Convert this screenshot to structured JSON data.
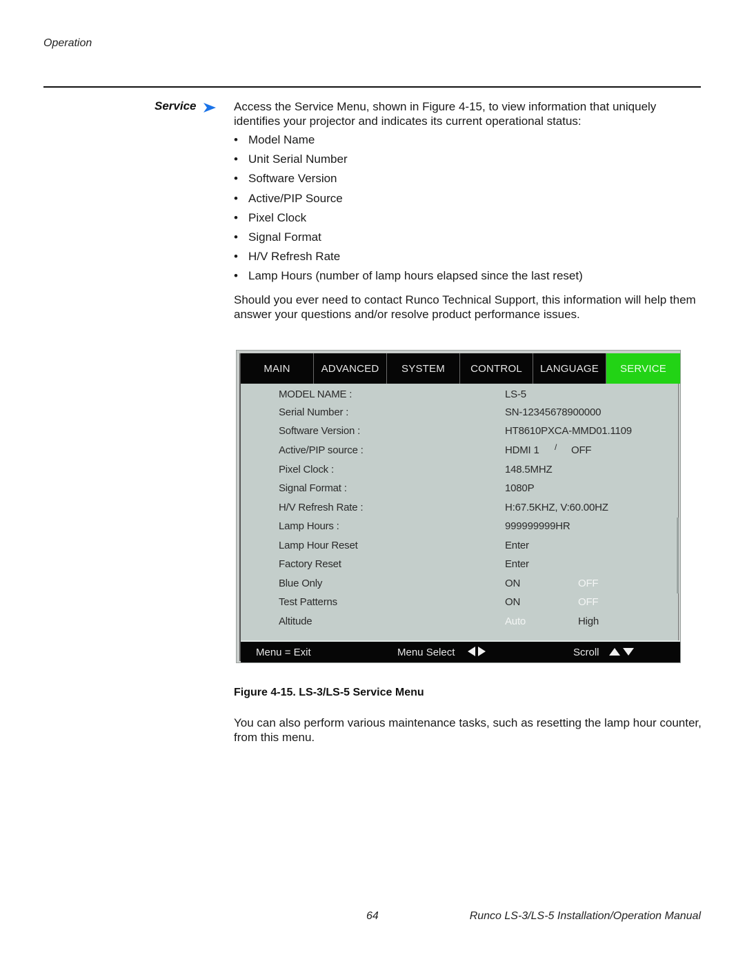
{
  "header": {
    "running_head": "Operation"
  },
  "section": {
    "side_head": "Service",
    "side_head_icon": "arrow-right-icon",
    "accent_color": "#1a73e8",
    "intro": "Access the Service Menu, shown in Figure 4-15, to view information that uniquely identifies your projector and indicates its current operational status:",
    "bullets": [
      "Model Name",
      "Unit Serial Number",
      "Software Version",
      "Active/PIP Source",
      "Pixel Clock",
      "Signal Format",
      "H/V Refresh Rate",
      "Lamp Hours (number of lamp hours elapsed since the last reset)"
    ],
    "bullet_glyph": "•",
    "support_text": "Should you ever need to contact Runco Technical Support, this information will help them answer your questions and/or resolve product performance issues."
  },
  "osd_menu": {
    "active_tab_color": "#22d315",
    "tabs": [
      {
        "label": "MAIN",
        "active": false
      },
      {
        "label": "ADVANCED",
        "active": false
      },
      {
        "label": "SYSTEM",
        "active": false
      },
      {
        "label": "CONTROL",
        "active": false
      },
      {
        "label": "LANGUAGE",
        "active": false
      },
      {
        "label": "SERVICE",
        "active": true
      }
    ],
    "rows": [
      {
        "label": "MODEL NAME :",
        "value": "LS-5"
      },
      {
        "label": "Serial Number :",
        "value": "SN-12345678900000"
      },
      {
        "label": "Software Version :",
        "value": "HT8610PXCA-MMD01.1109"
      },
      {
        "label": "Active/PIP source :",
        "value": "HDMI 1",
        "separator": "/",
        "value2": "OFF"
      },
      {
        "label": "Pixel Clock :",
        "value": "148.5MHZ"
      },
      {
        "label": "Signal Format :",
        "value": "1080P"
      },
      {
        "label": "H/V Refresh Rate :",
        "value": "H:67.5KHZ, V:60.00HZ"
      },
      {
        "label": "Lamp Hours :",
        "value": "999999999HR"
      },
      {
        "label": "Lamp Hour Reset",
        "value": "Enter"
      },
      {
        "label": "Factory Reset",
        "value": "Enter"
      },
      {
        "label": "Blue Only",
        "value": "ON",
        "value2": "OFF",
        "selected": "OFF"
      },
      {
        "label": "Test Patterns",
        "value": "ON",
        "value2": "OFF",
        "selected": "OFF"
      },
      {
        "label": "Altitude",
        "value": "Auto",
        "value2": "High",
        "selected": "Auto"
      }
    ],
    "footer": {
      "exit": "Menu = Exit",
      "select": "Menu Select",
      "select_icons": [
        "arrow-left-icon",
        "arrow-right-icon"
      ],
      "scroll": "Scroll",
      "scroll_icons": [
        "arrow-up-icon",
        "arrow-down-icon"
      ]
    }
  },
  "figure": {
    "caption": "Figure 4-15. LS-3/LS-5 Service Menu"
  },
  "after_text": "You can also perform various maintenance tasks, such as resetting the lamp hour counter, from this menu.",
  "footer": {
    "page_number": "64",
    "manual_title": "Runco LS-3/LS-5 Installation/Operation Manual"
  }
}
